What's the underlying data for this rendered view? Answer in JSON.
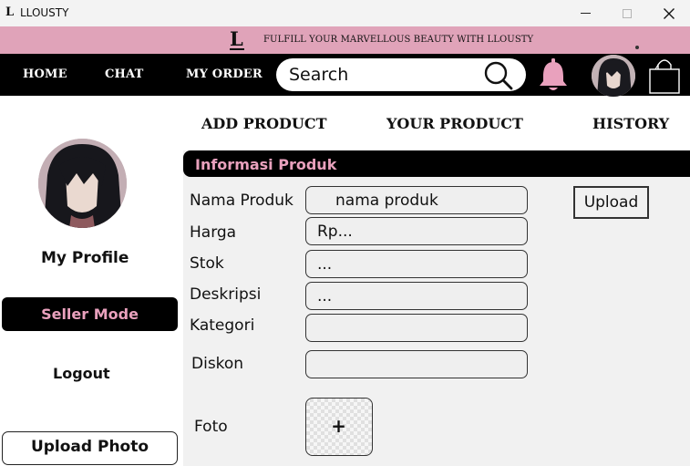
{
  "window": {
    "logo_letter": "L",
    "title": "LLOUSTY",
    "close_glyph": "✕"
  },
  "banner": {
    "logo_letter": "L",
    "tagline": "FULFILL YOUR MARVELLOUS BEAUTY WITH LLOUSTY",
    "color": "#e0a3b9"
  },
  "nav": {
    "home": "HOME",
    "chat": "CHAT",
    "my_order": "MY ORDER",
    "search_placeholder": "Search",
    "bell_color": "#e9a1bd"
  },
  "tabs": {
    "add_product": "ADD PRODUCT",
    "your_product": "YOUR PRODUCT",
    "history": "HISTORY"
  },
  "sidebar": {
    "my_profile": "My Profile",
    "seller_mode": "Seller Mode",
    "logout": "Logout",
    "upload_photo": "Upload Photo",
    "accent": "#e9a1bd"
  },
  "form": {
    "title": "Informasi Produk",
    "upload_button": "Upload",
    "fields": [
      {
        "label": "Nama Produk",
        "placeholder": "nama produk"
      },
      {
        "label": "Harga",
        "placeholder": "Rp..."
      },
      {
        "label": "Stok",
        "placeholder": "..."
      },
      {
        "label": "Deskripsi",
        "placeholder": "..."
      },
      {
        "label": "Kategori",
        "placeholder": ""
      },
      {
        "label": "Diskon",
        "placeholder": ""
      }
    ],
    "foto_label": "Foto",
    "foto_add": "+"
  }
}
